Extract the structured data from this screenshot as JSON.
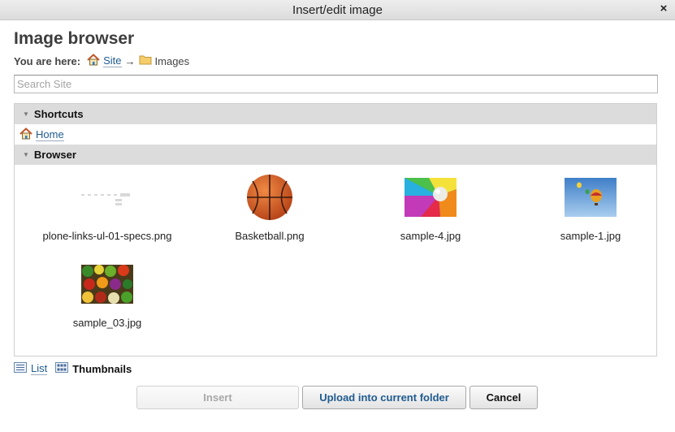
{
  "window": {
    "title": "Insert/edit image",
    "close_glyph": "×"
  },
  "heading": "Image browser",
  "breadcrumb": {
    "lead": "You are here:",
    "items": [
      {
        "label": "Site",
        "icon": "home-icon"
      },
      {
        "label": "Images",
        "icon": "folder-icon"
      }
    ],
    "separator": "→"
  },
  "search": {
    "placeholder": "Search Site",
    "value": ""
  },
  "shortcuts": {
    "title": "Shortcuts",
    "items": [
      {
        "label": "Home",
        "icon": "home-icon"
      }
    ]
  },
  "browser": {
    "title": "Browser",
    "items": [
      {
        "name": "plone-links-ul-01-specs.png",
        "thumb": "specs-diagram"
      },
      {
        "name": "Basketball.png",
        "thumb": "basketball"
      },
      {
        "name": "sample-4.jpg",
        "thumb": "color-swirl"
      },
      {
        "name": "sample-1.jpg",
        "thumb": "balloons-sky"
      },
      {
        "name": "sample_03.jpg",
        "thumb": "vegetables"
      }
    ]
  },
  "view_modes": {
    "list": "List",
    "thumbnails": "Thumbnails",
    "active": "Thumbnails"
  },
  "buttons": {
    "insert": "Insert",
    "upload": "Upload into current folder",
    "cancel": "Cancel"
  },
  "colors": {
    "link": "#205c90",
    "section_bg": "#dcdcdc",
    "title_bar": "#e4e4e4"
  }
}
